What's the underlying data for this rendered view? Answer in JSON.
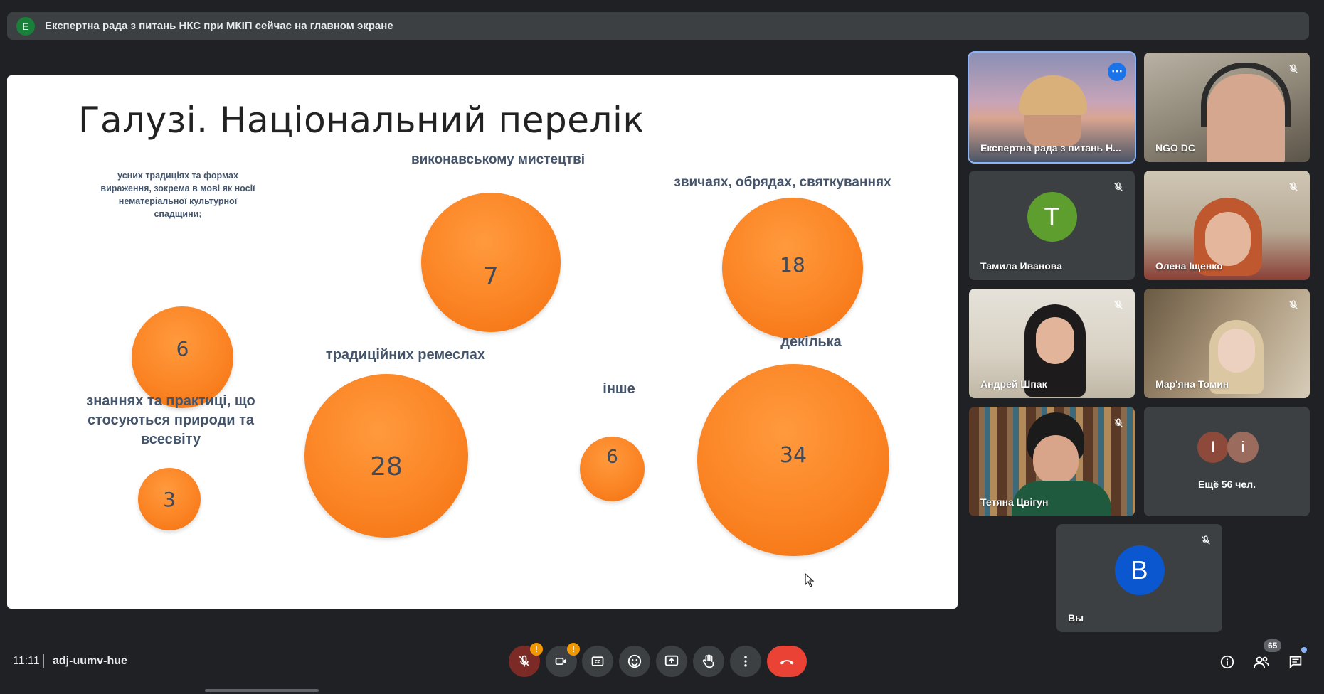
{
  "banner": {
    "initial": "E",
    "text": "Експертна рада з питань НКС при МКІП сейчас на главном экране"
  },
  "slide": {
    "title": "Галузі. Національний перелік",
    "bubbles": [
      {
        "label": "усних традиціях та формах вираження, зокрема в мові як носії нематеріальної культурної спадщини;",
        "value": "6"
      },
      {
        "label": "виконавському мистецтві",
        "value": "7"
      },
      {
        "label": "звичаях, обрядах, святкуваннях",
        "value": "18"
      },
      {
        "label": "знаннях та практиці, що стосуються природи та всесвіту",
        "value": "3"
      },
      {
        "label": "традиційних ремеслах",
        "value": "28"
      },
      {
        "label": "інше",
        "value": "6"
      },
      {
        "label": "декілька",
        "value": "34"
      }
    ]
  },
  "participants": [
    {
      "name": "Експертна рада з питань Н...",
      "active": true
    },
    {
      "name": "NGO DC"
    },
    {
      "name": "Тамила Иванова",
      "initial": "T",
      "color": "#5e9e2f"
    },
    {
      "name": "Олена Іщенко"
    },
    {
      "name": "Андрей Шпак"
    },
    {
      "name": "Мар'яна Томин"
    },
    {
      "name": "Тетяна Цвігун"
    },
    {
      "name": "Ещё 56 чел.",
      "initials": [
        "I",
        "i"
      ]
    },
    {
      "name": "Вы",
      "initial": "B",
      "color": "#0b57d0"
    }
  ],
  "bottom": {
    "time": "11:11",
    "meeting_code": "adj-uumv-hue",
    "warning_mark": "!",
    "people_count": "65"
  },
  "icons": [
    "mic-off-icon",
    "camera-off-icon",
    "captions-icon",
    "emoji-icon",
    "present-icon",
    "raise-hand-icon",
    "more-vert-icon",
    "end-call-icon",
    "info-icon",
    "people-icon",
    "chat-icon"
  ]
}
